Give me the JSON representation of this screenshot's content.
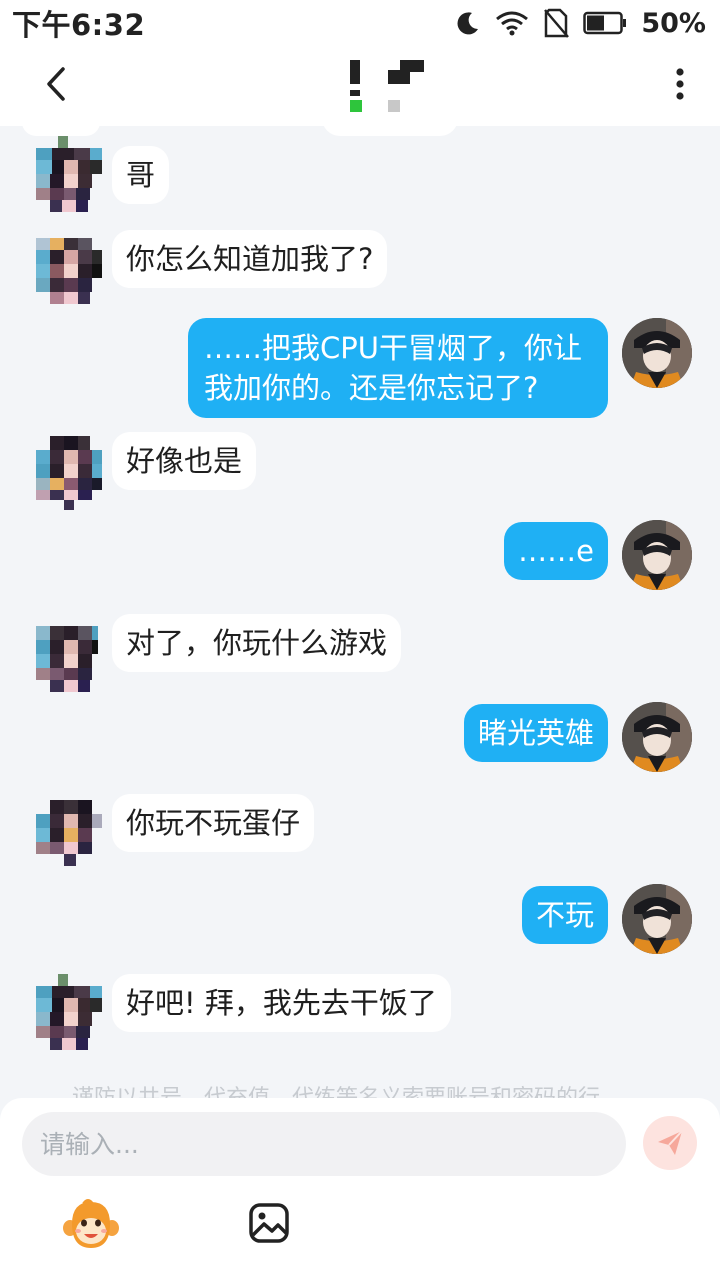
{
  "status_bar": {
    "time": "下午6:32",
    "battery": "50%"
  },
  "header": {
    "title_obscured": true
  },
  "messages": [
    {
      "side": "in",
      "text": "哥"
    },
    {
      "side": "in",
      "text": "你怎么知道加我了?"
    },
    {
      "side": "out",
      "text": "……把我CPU干冒烟了，你让我加你的。还是你忘记了?"
    },
    {
      "side": "in",
      "text": "好像也是"
    },
    {
      "side": "out",
      "text": "……e"
    },
    {
      "side": "in",
      "text": "对了，你玩什么游戏"
    },
    {
      "side": "out",
      "text": "睹光英雄"
    },
    {
      "side": "in",
      "text": "你玩不玩蛋仔"
    },
    {
      "side": "out",
      "text": "不玩"
    },
    {
      "side": "in",
      "text": "好吧! 拜，我先去干饭了"
    }
  ],
  "notice": "谨防以共号、代充值、代练等名义索要账号和密码的行",
  "composer": {
    "placeholder": "请输入..."
  },
  "icons": {
    "back": "chevron-left-icon",
    "more": "more-vertical-icon",
    "send": "send-icon",
    "emoji": "monkey-emoji-icon",
    "image": "image-icon"
  },
  "colors": {
    "outgoing_bubble": "#1fb0f4",
    "incoming_bubble": "#ffffff",
    "background": "#f3f5f8",
    "send_button": "#fde3df"
  }
}
